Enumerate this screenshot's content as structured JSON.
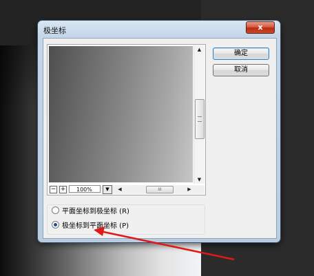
{
  "dialog": {
    "title": "极坐标",
    "close_label": "x",
    "ok_label": "确定",
    "cancel_label": "取消"
  },
  "preview": {
    "zoom_out_label": "−",
    "zoom_in_label": "+",
    "zoom_value": "100%",
    "scroll_thumb_grip": "III"
  },
  "options": [
    {
      "label": "平面坐标到极坐标 (R)",
      "selected": false
    },
    {
      "label": "极坐标到平面坐标 (P)",
      "selected": true
    }
  ],
  "colors": {
    "arrow": "#e01818",
    "title_bar": "#c4d6e8",
    "close_button": "#c83a1e"
  }
}
